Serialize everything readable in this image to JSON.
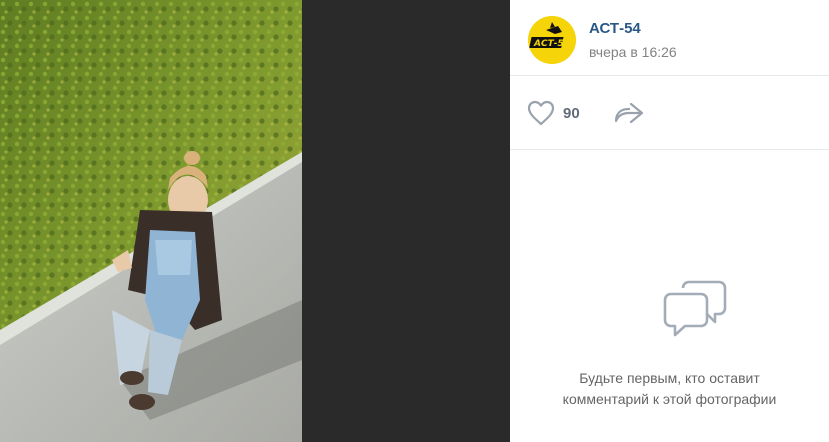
{
  "post": {
    "author": "АСТ-54",
    "time": "вчера в 16:26",
    "avatar_text": "АСТ-54",
    "likes": "90"
  },
  "comments": {
    "empty_line1": "Будьте первым, кто оставит",
    "empty_line2": "комментарий к этой фотографии"
  },
  "icons": {
    "like": "heart-icon",
    "share": "share-arrow-icon",
    "comments": "speech-bubbles-icon"
  },
  "colors": {
    "link": "#2a5885",
    "avatar_bg": "#f6d40a",
    "icon_gray": "#99a2ad",
    "viewer_dark": "#2a2a2a"
  }
}
